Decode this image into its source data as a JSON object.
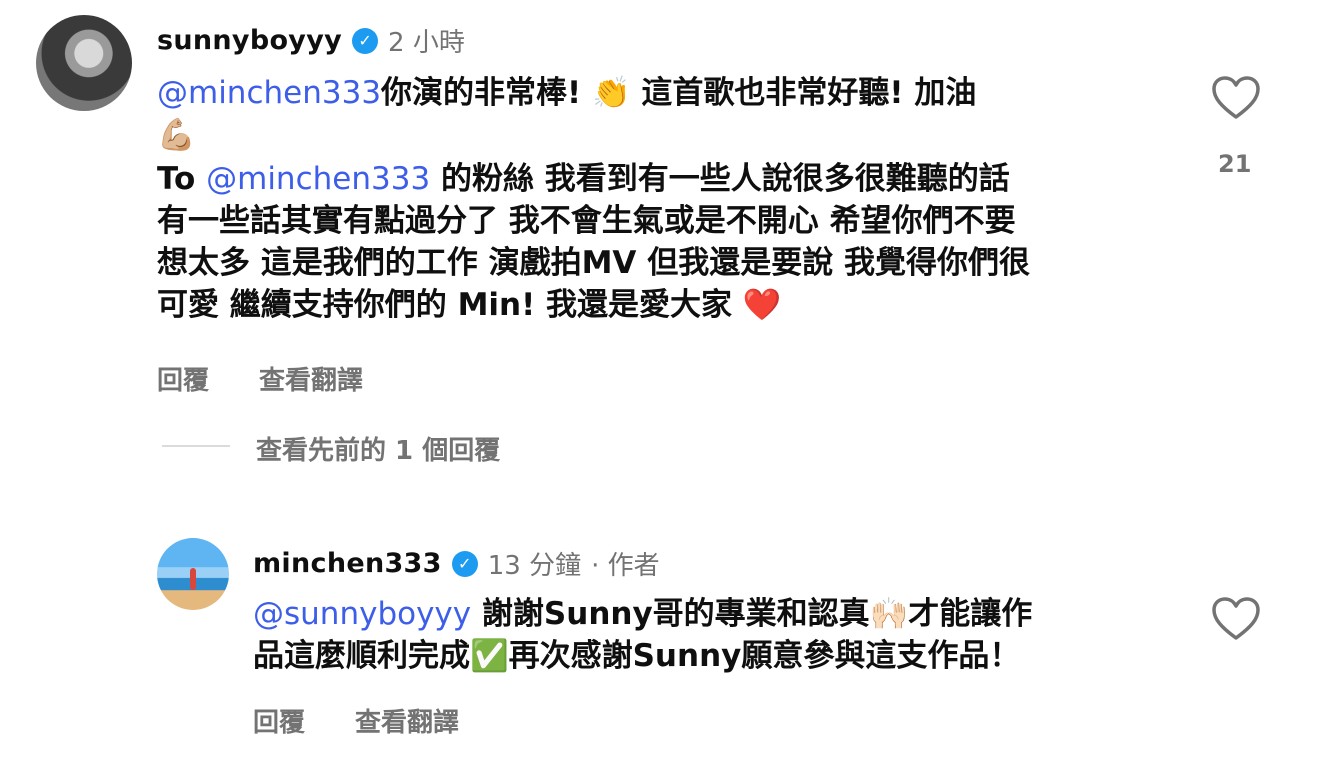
{
  "comments": [
    {
      "username": "sunnyboyyy",
      "time": "2 小時",
      "mention": "@minchen333",
      "text1": "你演的非常棒! ",
      "emoji1": "👏",
      "text2": " 這首歌也非常好聽! 加油",
      "emoji2": "💪🏼",
      "para2_prefix": "To ",
      "para2_mention": "@minchen333",
      "para2_line1": " 的粉絲 我看到有一些人說很多很難聽的話",
      "para2_line2": "有一些話其實有點過分了 我不會生氣或是不開心 希望你們不要",
      "para2_line3": "想太多 這是我們的工作 演戲拍MV 但我還是要說 我覺得你們很",
      "para2_line4": "可愛 繼續支持你們的 Min! 我還是愛大家 ",
      "heart_emoji": "❤️",
      "reply_label": "回覆",
      "translate_label": "查看翻譯",
      "like_count": "21"
    }
  ],
  "view_previous": "查看先前的 1 個回覆",
  "reply": {
    "username": "minchen333",
    "time": "13 分鐘",
    "author_tag": "· 作者",
    "mention": "@sunnyboyyy",
    "text1": " 謝謝Sunny哥的專業和認真",
    "emoji1": "🙌🏻",
    "text2": "才能讓作",
    "line2a": "品這麼順利完成",
    "emoji2": "✅",
    "line2b": "再次感謝Sunny願意參與這支作品！",
    "reply_label": "回覆",
    "translate_label": "查看翻譯"
  },
  "colors": {
    "mention": "#3d5ee8",
    "verified": "#1d9bf0",
    "meta": "#737373"
  }
}
